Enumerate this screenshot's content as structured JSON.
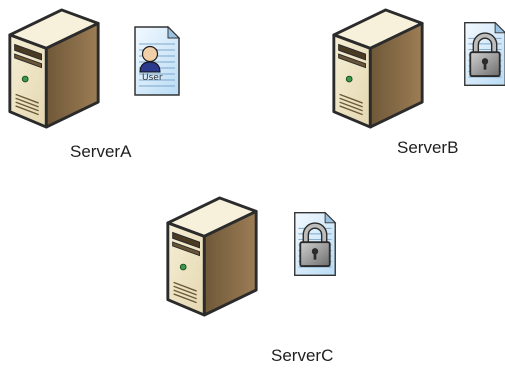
{
  "servers": [
    {
      "name": "ServerA",
      "doc_icon": "user-document-icon",
      "doc_text": "User"
    },
    {
      "name": "ServerB",
      "doc_icon": "locked-document-icon"
    },
    {
      "name": "ServerC",
      "doc_icon": "locked-document-icon"
    }
  ],
  "colors": {
    "tower_front": "#efe6c8",
    "tower_top": "#f7f1dc",
    "tower_side": "#7a6243",
    "outline": "#2b2b2b",
    "doc_fill": "#dcefff",
    "lock": "#8a8a8a",
    "user_shirt": "#2b3a8c"
  }
}
